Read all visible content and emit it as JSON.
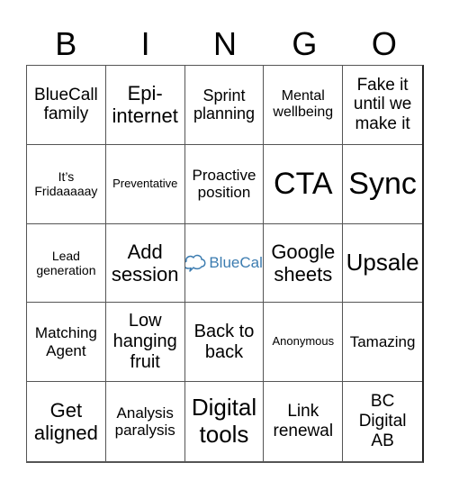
{
  "header": {
    "letters": [
      "B",
      "I",
      "N",
      "G",
      "O"
    ]
  },
  "free_space": {
    "logo_text": "BlueCall",
    "logo_color": "#3c7cb0",
    "icon": "speech-cloud-icon"
  },
  "cells": [
    "BlueCall family",
    "Epi-internet",
    "Sprint planning",
    "Mental wellbeing",
    "Fake it until we make it",
    "It's Fridaaaaay",
    "Preventative",
    "Proactive position",
    "CTA",
    "Sync",
    "Lead generation",
    "Add session",
    "FREE",
    "Google sheets",
    "Upsale",
    "Matching Agent",
    "Low hanging fruit",
    "Back to back",
    "Anonymous",
    "Tamazing",
    "Get aligned",
    "Analysis paralysis",
    "Digital tools",
    "Link renewal",
    "BC Digital AB"
  ],
  "cell_lines": {
    "c0": [
      "BlueCall",
      "family"
    ],
    "c1": [
      "Epi-",
      "internet"
    ],
    "c2": [
      "Sprint",
      "planning"
    ],
    "c3": [
      "Mental",
      "wellbeing"
    ],
    "c4": [
      "Fake it",
      "until we",
      "make it"
    ],
    "c5": [
      "It’s",
      "Fridaaaaay"
    ],
    "c6": [
      "Preventative"
    ],
    "c7": [
      "Proactive",
      "position"
    ],
    "c8": [
      "CTA"
    ],
    "c9": [
      "Sync"
    ],
    "c10": [
      "Lead",
      "generation"
    ],
    "c11": [
      "Add",
      "session"
    ],
    "c13": [
      "Google",
      "sheets"
    ],
    "c14": [
      "Upsale"
    ],
    "c15": [
      "Matching",
      "Agent"
    ],
    "c16": [
      "Low",
      "hanging",
      "fruit"
    ],
    "c17": [
      "Back to",
      "back"
    ],
    "c18": [
      "Anonymous"
    ],
    "c19": [
      "Tamazing"
    ],
    "c20": [
      "Get",
      "aligned"
    ],
    "c21": [
      "Analysis",
      "paralysis"
    ],
    "c22": [
      "Digital",
      "tools"
    ],
    "c23": [
      "Link",
      "renewal"
    ],
    "c24": [
      "BC",
      "Digital",
      "AB"
    ]
  }
}
